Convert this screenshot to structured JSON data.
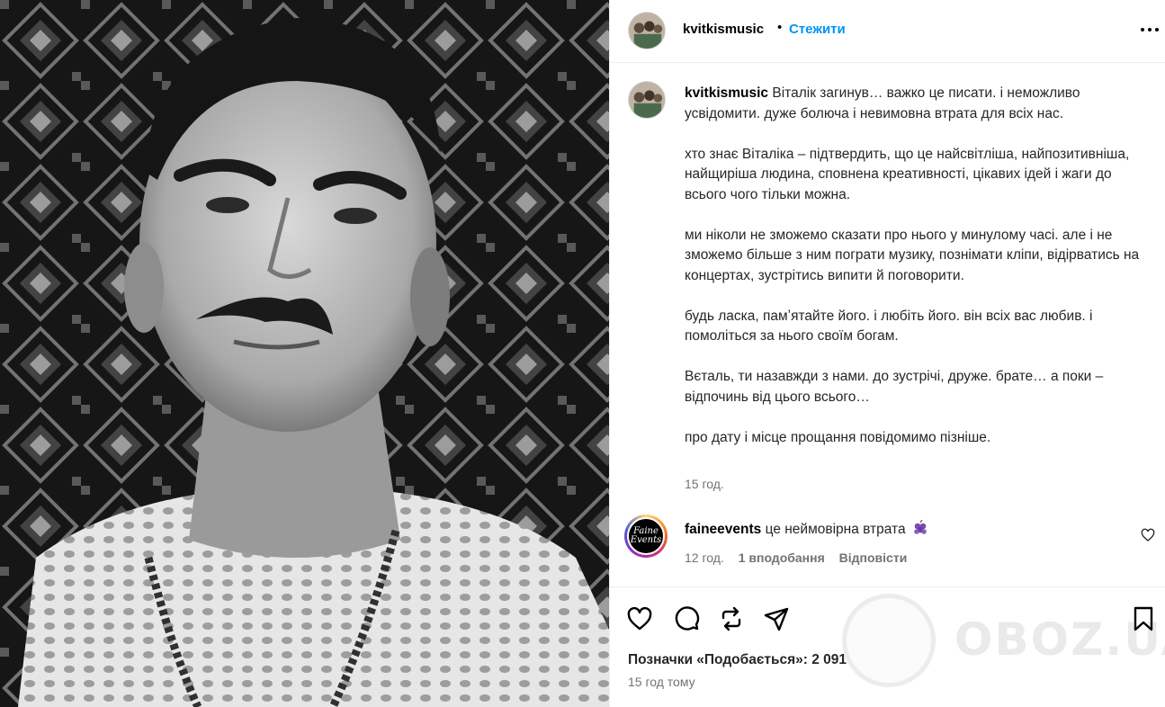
{
  "post": {
    "username": "kvitkismusic",
    "follow_label": "Стежити",
    "separator": "•",
    "caption_lines": [
      "Віталік загинув… важко це писати. і неможливо усвідомити. дуже болюча і невимовна втрата для всіх нас.",
      "",
      "хто знає Віталіка – підтвердить, що це найсвітліша, найпозитивніша, найщиріша людина, сповнена креативності, цікавих ідей і жаги до всього чого тільки можна.",
      "",
      "ми ніколи не зможемо сказати про нього у минулому часі. але і не зможемо більше з ним пограти музику, познімати кліпи, відірватись на концертах, зустрітись випити й поговорити.",
      "",
      "будь ласка, памʼятайте його. і любіть його. він всіх вас любив. і помоліться за нього своїм богам.",
      "",
      "Вєталь, ти назавжди з нами. до зустрічі, друже. брате… а поки – відпочинь від цього всього…",
      "",
      "про дату і місце прощання повідомимо пізніше."
    ],
    "caption_time": "15 год."
  },
  "comment": {
    "username": "faineevents",
    "text": "це неймовірна втрата",
    "avatar_text_top": "Faine",
    "avatar_text_bottom": "Events",
    "time": "12 год.",
    "likes": "1 вподобання",
    "reply_label": "Відповісти"
  },
  "actions": {
    "likes_text": "Позначки «Подобається»: 2 091",
    "posted_ago": "15 год тому"
  },
  "watermark": {
    "text": "OBOZ.UA"
  },
  "icons": [
    "more-icon",
    "heart-icon",
    "comment-icon",
    "repost-icon",
    "share-icon",
    "bookmark-icon",
    "grape-icon"
  ],
  "colors": {
    "accent": "#0095f6",
    "secondary_text": "#737373",
    "border": "#efefef"
  }
}
